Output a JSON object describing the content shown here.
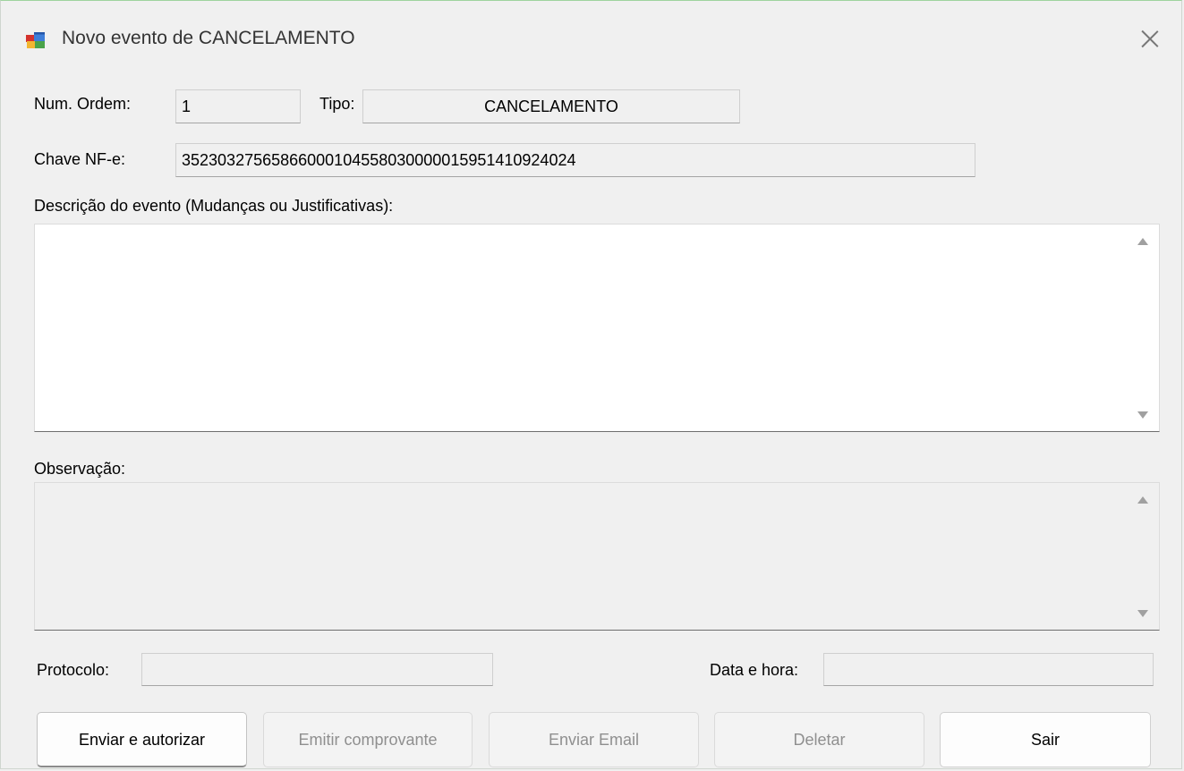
{
  "window": {
    "title": "Novo evento de CANCELAMENTO"
  },
  "form": {
    "num_ordem_label": "Num. Ordem:",
    "num_ordem_value": "1",
    "tipo_label": "Tipo:",
    "tipo_value": "CANCELAMENTO",
    "chave_label": "Chave NF-e:",
    "chave_value": "35230327565866000104558030000015951410924024",
    "descricao_label": "Descrição do evento (Mudanças ou Justificativas):",
    "descricao_value": "",
    "observacao_label": "Observação:",
    "observacao_value": "",
    "protocolo_label": "Protocolo:",
    "protocolo_value": "",
    "data_hora_label": "Data e hora:",
    "data_hora_value": ""
  },
  "buttons": {
    "enviar_autorizar": "Enviar e autorizar",
    "emitir_comprovante": "Emitir comprovante",
    "enviar_email": "Enviar Email",
    "deletar": "Deletar",
    "sair": "Sair"
  },
  "icons": {
    "app": "windows-form-icon",
    "close": "close-icon",
    "scroll_up": "scroll-up-arrow-icon",
    "scroll_down": "scroll-down-arrow-icon"
  },
  "colors": {
    "background": "#f0f0f0",
    "memo_active": "#ffffff",
    "disabled_text": "#8f8f8f"
  }
}
